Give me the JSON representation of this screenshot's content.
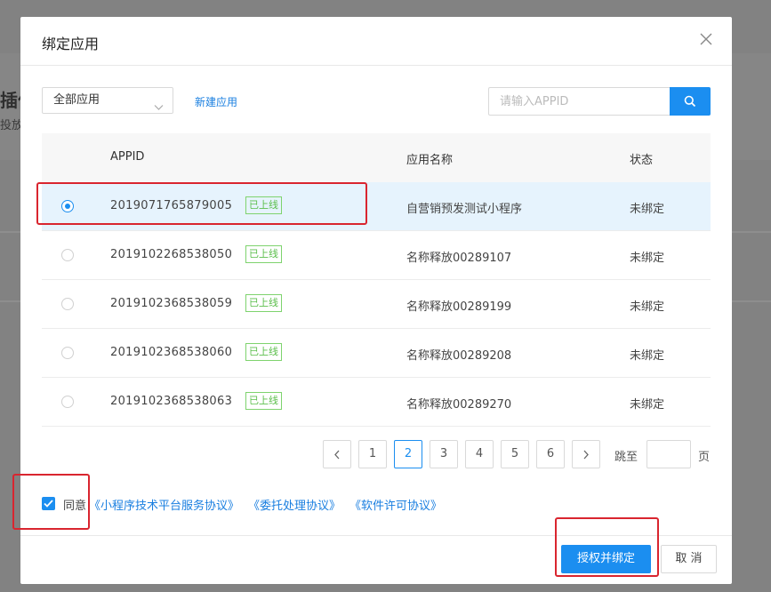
{
  "background": {
    "title_fragment": "插件",
    "subtitle_fragment": "投放"
  },
  "dialog": {
    "title": "绑定应用",
    "close_icon": "close-icon"
  },
  "filter": {
    "select_value": "全部应用",
    "new_app_label": "新建应用",
    "search_placeholder": "请输入APPID",
    "search_icon": "search-icon"
  },
  "table": {
    "headers": {
      "appid": "APPID",
      "name": "应用名称",
      "status": "状态"
    },
    "rows": [
      {
        "appid": "2019071765879005",
        "badge": "已上线",
        "name": "自营销预发测试小程序",
        "status": "未绑定",
        "selected": true
      },
      {
        "appid": "2019102268538050",
        "badge": "已上线",
        "name": "名称释放00289107",
        "status": "未绑定",
        "selected": false
      },
      {
        "appid": "2019102368538059",
        "badge": "已上线",
        "name": "名称释放00289199",
        "status": "未绑定",
        "selected": false
      },
      {
        "appid": "2019102368538060",
        "badge": "已上线",
        "name": "名称释放00289208",
        "status": "未绑定",
        "selected": false
      },
      {
        "appid": "2019102368538063",
        "badge": "已上线",
        "name": "名称释放00289270",
        "status": "未绑定",
        "selected": false
      }
    ]
  },
  "pagination": {
    "pages": [
      "1",
      "2",
      "3",
      "4",
      "5",
      "6"
    ],
    "current": "2",
    "goto_label": "跳至",
    "page_suffix": "页"
  },
  "agreement": {
    "checked": true,
    "prefix": "同意",
    "links": [
      "《小程序技术平台服务协议》",
      "《委托处理协议》",
      "《软件许可协议》"
    ]
  },
  "footer": {
    "confirm_label": "授权并绑定",
    "cancel_label": "取 消"
  },
  "colors": {
    "primary": "#1b8ef0",
    "badge_green": "#5cbf4c",
    "highlight_red": "#d9252f",
    "selected_row": "#e6f3fd"
  }
}
